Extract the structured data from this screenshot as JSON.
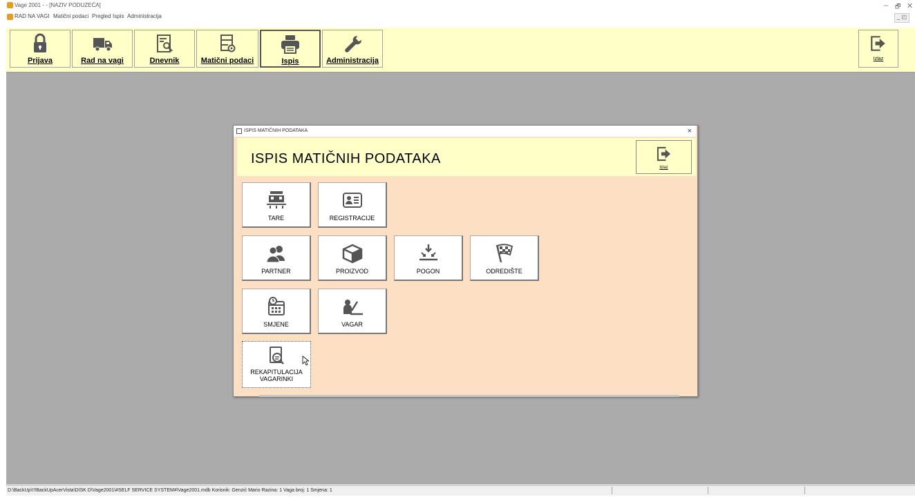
{
  "window": {
    "title": "Vage 2001 - - [NAZIV PODUZEĆA]",
    "controls": {
      "minimize": "–",
      "restore": "🗗",
      "close": "✕"
    }
  },
  "menubar": {
    "items": [
      "RAD NA VAGI",
      "Matični podaci",
      "Pregled",
      "Ispis",
      "Administracija"
    ],
    "mdi_controls": "_ ◰"
  },
  "toolbar": {
    "buttons": [
      {
        "label": "Prijava",
        "icon": "lock-icon"
      },
      {
        "label": "Rad na vagi",
        "icon": "truck-icon"
      },
      {
        "label": "Dnevnik",
        "icon": "journal-search-icon"
      },
      {
        "label": "Matični podaci",
        "icon": "data-settings-icon"
      },
      {
        "label": "Ispis",
        "icon": "printer-icon",
        "active": true
      },
      {
        "label": "Administracija",
        "icon": "wrench-icon"
      }
    ],
    "exit_label": "Izlaz"
  },
  "dialog": {
    "title": "ISPIS MATIČNIH PODATAKA",
    "heading": "ISPIS MATIČNIH PODATAKA",
    "exit_label": "Izlaz",
    "close": "×",
    "tiles": {
      "tare": "TARE",
      "registracije": "REGISTRACIJE",
      "partner": "PARTNER",
      "proizvod": "PROIZVOD",
      "pogon": "POGON",
      "odrediste": "ODREDIŠTE",
      "smjene": "SMJENE",
      "vagar": "VAGAR",
      "rekapitulacija": "REKAPITULACIJA VAGARINKI"
    }
  },
  "statusbar": {
    "text": "D:\\BackUp\\!!!BackUpAcerVista\\DISK D\\Vage2001\\#SELF SERVICE SYSTEM#\\Vage2001.mdb  Korisnik: Genzić Mario   Razina: 1   Vaga broj: 1    Smjena: 1"
  },
  "colors": {
    "toolbar_bg": "#ffffc8",
    "workspace_bg": "#ababab",
    "dialog_bg": "#fde0c4",
    "icon": "#555555"
  }
}
